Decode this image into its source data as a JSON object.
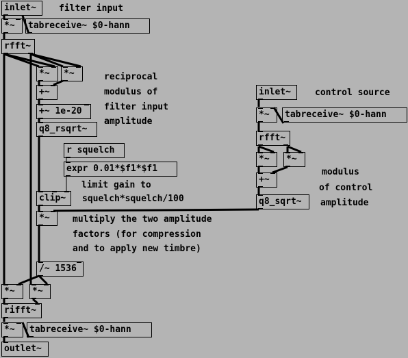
{
  "patch": {
    "objects": {
      "inlet_filter": "inlet~",
      "mul_window_in": "*~",
      "tabreceive_in": "tabreceive~ $0-hann",
      "rfft_in": "rfft~",
      "mul_re": "*~",
      "mul_im": "*~",
      "add_sq": "+~",
      "add_eps": "+~ 1e-20",
      "rsqrt": "q8_rsqrt~",
      "r_squelch": "r squelch",
      "expr": "expr 0.01*$f1*$f1",
      "clip": "clip~",
      "mul_amp": "*~",
      "div_norm": "/~ 1536",
      "mul_out_re": "*~",
      "mul_out_im": "*~",
      "rifft": "rifft~",
      "mul_window_out": "*~",
      "tabreceive_out": "tabreceive~ $0-hann",
      "outlet": "outlet~",
      "inlet_control": "inlet~",
      "mul_window_ctl": "*~",
      "tabreceive_ctl": "tabreceive~ $0-hann",
      "rfft_ctl": "rfft~",
      "mul_ctl_re": "*~",
      "mul_ctl_im": "*~",
      "add_ctl": "+~",
      "sqrt_ctl": "q8_sqrt~"
    },
    "comments": {
      "filter_input": "filter input",
      "reciprocal_1": "reciprocal",
      "reciprocal_2": "modulus of",
      "reciprocal_3": "filter input",
      "reciprocal_4": "amplitude",
      "limit_1": "limit gain to",
      "limit_2": "squelch*squelch/100",
      "multiply_1": "multiply the two amplitude",
      "multiply_2": "factors (for compression",
      "multiply_3": "and to apply new timbre)",
      "control_source": "control source",
      "modulus_1": "modulus",
      "modulus_2": "of control",
      "modulus_3": "amplitude"
    }
  }
}
